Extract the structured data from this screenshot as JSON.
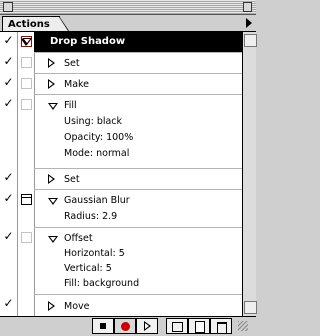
{
  "panel": {
    "tab_label": "Actions"
  },
  "actions": {
    "selected_set": "Drop Shadow",
    "set": "Set",
    "make": "Make",
    "fill": {
      "label": "Fill",
      "using": "Using: black",
      "opacity": "Opacity: 100%",
      "mode": "Mode: normal"
    },
    "set2": "Set",
    "gaussian_blur": {
      "label": "Gaussian Blur",
      "radius": "Radius: 2.9"
    },
    "offset": {
      "label": "Offset",
      "horizontal": "Horizontal: 5",
      "vertical": "Vertical: 5",
      "fill": "Fill: background"
    },
    "move": "Move"
  },
  "toolbar": {
    "buttons": [
      "stop",
      "record",
      "play",
      "new-set",
      "new-action",
      "delete"
    ]
  },
  "colors": {
    "record": "#cc0000",
    "selection": "#000000"
  }
}
